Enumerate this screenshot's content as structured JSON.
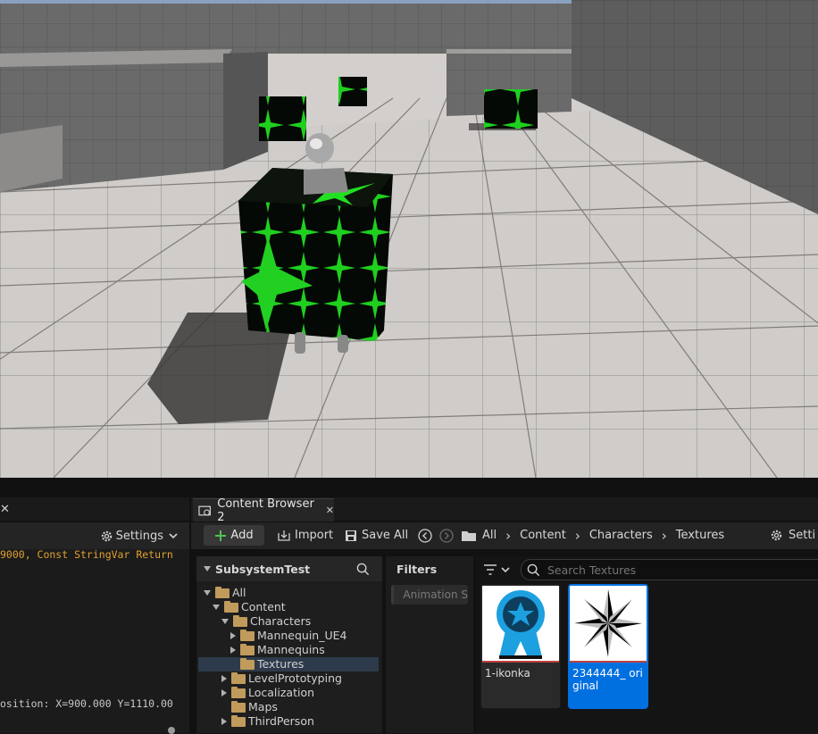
{
  "viewport": {
    "scene_description_icons": [
      "character-mannequin",
      "green-star-cube"
    ]
  },
  "left_panel": {
    "toolbar": {
      "settings_label": "Settings"
    },
    "log_lines": [
      "9000, Const StringVar Return",
      "osition: X=900.000 Y=1110.00"
    ],
    "colors": {
      "log_text": "#e0a030",
      "plain_text": "#c8c8c8"
    }
  },
  "content_browser": {
    "tab_title": "Content Browser 2",
    "toolbar": {
      "add_label": "Add",
      "import_label": "Import",
      "save_all_label": "Save All",
      "breadcrumbs": [
        "All",
        "Content",
        "Characters",
        "Textures"
      ],
      "settings_label": "Setti"
    },
    "tree": {
      "header": "SubsystemTest",
      "items": [
        {
          "label": "All",
          "depth": 0,
          "expanded": true,
          "selected": false
        },
        {
          "label": "Content",
          "depth": 1,
          "expanded": true,
          "selected": false
        },
        {
          "label": "Characters",
          "depth": 2,
          "expanded": true,
          "selected": false
        },
        {
          "label": "Mannequin_UE4",
          "depth": 3,
          "expanded": false,
          "selected": false
        },
        {
          "label": "Mannequins",
          "depth": 3,
          "expanded": false,
          "selected": false
        },
        {
          "label": "Textures",
          "depth": 3,
          "expanded": null,
          "selected": true
        },
        {
          "label": "LevelPrototyping",
          "depth": 2,
          "expanded": false,
          "selected": false
        },
        {
          "label": "Localization",
          "depth": 2,
          "expanded": null,
          "selected": false
        },
        {
          "label": "Maps",
          "depth": 2,
          "expanded": null,
          "selected": false
        },
        {
          "label": "ThirdPerson",
          "depth": 2,
          "expanded": false,
          "selected": false
        }
      ]
    },
    "filters": {
      "header": "Filters",
      "chip": "Animation S"
    },
    "search": {
      "placeholder": "Search Textures"
    },
    "assets": [
      {
        "name": "1-ikonka",
        "icon": "award-ribbon-icon",
        "selected": false
      },
      {
        "name": "2344444_ original",
        "icon": "star-compass-icon",
        "selected": true
      }
    ],
    "colors": {
      "accent": "#0070e0",
      "selected_row": "#2d3a4b",
      "add_icon": "#4ec24e",
      "folder": "#c19b5c"
    }
  }
}
